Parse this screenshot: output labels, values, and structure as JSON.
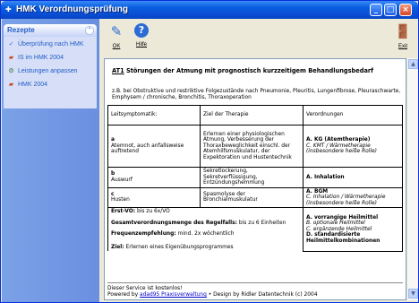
{
  "window": {
    "title": "HMK Verordnungsprüfung"
  },
  "sidebar": {
    "header": "Rezepte",
    "items": [
      {
        "label": "Überprüfung nach HMK",
        "icon": "check-document-icon"
      },
      {
        "label": "IS im HMK 2004",
        "icon": "book-icon"
      },
      {
        "label": "Leistungen anpassen",
        "icon": "gear-icon"
      },
      {
        "label": "HMK 2004",
        "icon": "book-icon"
      }
    ]
  },
  "toolbar": {
    "ok_label": "OK",
    "help_label": "Hilfe",
    "exit_label": "Exit"
  },
  "doc": {
    "heading_code": "AT1",
    "heading_text": " Störungen der Atmung mit prognostisch kurzzeitigem Behandlungsbedarf",
    "intro": "z.B. bei Obstruktive und restriktive Folgezustände nach Pneumonie, Pleuritis, Lungenfibrose, Pleuraschwarte, Emphysem / chronische, Bronchitis, Thoraxoperation",
    "col_headers": [
      "Leitsymptomatik:",
      "Ziel der Therapie",
      "Verordnungen"
    ],
    "rows": [
      {
        "code": "a",
        "symptom": "Atemnot, auch anfallsweise auftretend",
        "goal": "Erlernen einer physiologischen Atmung, Verbesserung der Thoraxbeweglichkeit einschl. der Atemhilfsmuskulatur, der Expektoration und Hustentechnik",
        "order_main": "A. KG (Atemtherapie)",
        "order_sub": "C. KMT / Wärmetherapie (insbesondere heiße Rolle)"
      },
      {
        "code": "b",
        "symptom": "Auswurf",
        "goal": "Sekretlockerung, Sekretverflüssigung, Entzündungshemmung",
        "order_main": "A. Inhalation",
        "order_sub": ""
      },
      {
        "code": "c",
        "symptom": "Husten",
        "goal": "Spasmolyse der Bronchialmuskulatur",
        "order_main": "A. BGM",
        "order_sub": "C. Inhalation / Wärmetherapie (insbesondere heiße Rolle)"
      }
    ],
    "erst_vo_label": "Erst-VO:",
    "erst_vo_value": " bis zu 6x/VO",
    "gesamt_label": "Gesamtverordnungsmenge des Regelfalls:",
    "gesamt_value": " bis zu 6 Einheiten",
    "freq_label": "Frequenzempfehlung:",
    "freq_value": " mind. 2x wöchentlich",
    "ziel_label": "Ziel:",
    "ziel_value": " Erlernen eines Eigenübungsprogrammes",
    "remedy_a": "A. vorrangige Heilmittel",
    "remedy_b": "B. optionale Heilmittel",
    "remedy_c": "C. ergänzende Heilmittel",
    "remedy_d": "D. standardisierte Heilmittelkombinationen"
  },
  "footer": {
    "line1": "Dieser Service ist kostenlos!",
    "powered_prefix": "Powered by ",
    "link_text": "adad95 Praxisverwaltung",
    "powered_suffix": " • Design by Ridler Datentechnik (c) 2004"
  }
}
